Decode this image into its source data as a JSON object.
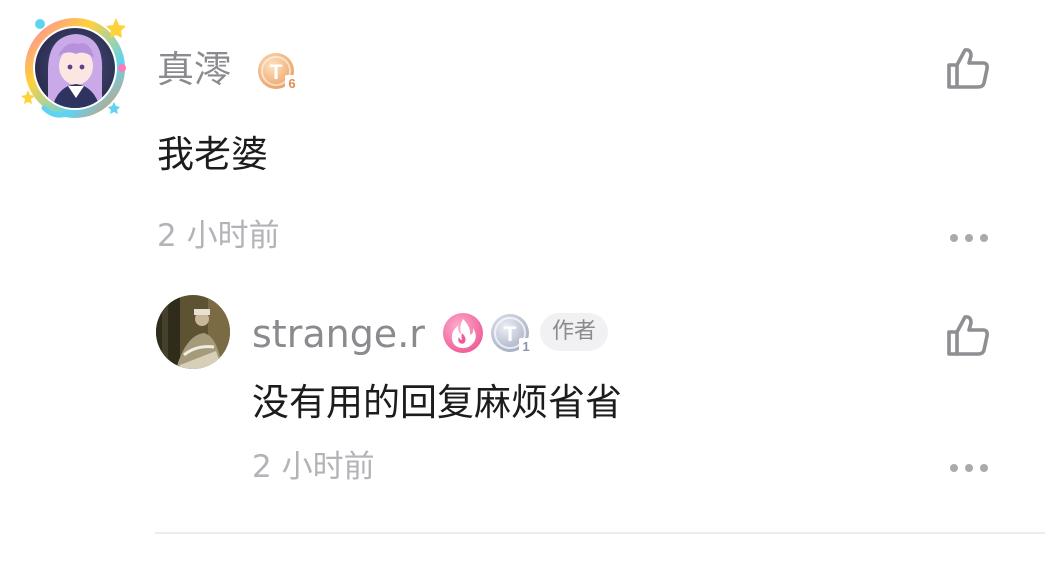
{
  "comment": {
    "username": "真澪",
    "avatar_icon": "anime-character-avatar",
    "badge": {
      "icon": "t-level-badge",
      "letter": "T",
      "level": "6",
      "color": "#f3b27a"
    },
    "content": "我老婆",
    "time": "2 小时前",
    "like_icon": "thumbs-up-icon",
    "more_icon": "more-dots-icon"
  },
  "reply": {
    "username": "strange.r",
    "avatar_icon": "photo-avatar",
    "fire_badge": {
      "icon": "fire-badge-icon",
      "color": "#f0609a"
    },
    "tier_badge": {
      "icon": "t-level-badge",
      "letter": "T",
      "level": "1",
      "color": "#aab2c8"
    },
    "author_tag": "作者",
    "content": "没有用的回复麻烦省省",
    "time": "2 小时前",
    "like_icon": "thumbs-up-icon",
    "more_icon": "more-dots-icon"
  },
  "colors": {
    "username": "#8a8a8f",
    "content": "#1c1c1e",
    "time": "#b3b3b8",
    "icon": "#8e8e93",
    "divider": "#ececef"
  }
}
